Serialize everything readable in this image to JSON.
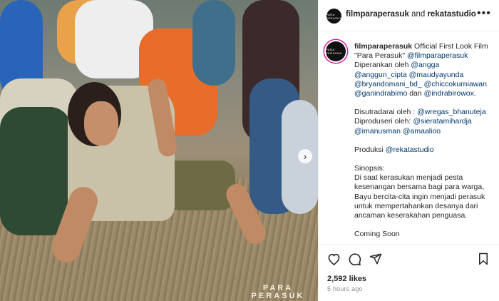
{
  "header": {
    "account": "filmparaperasuk",
    "joiner": "and",
    "collaborator": "rekatastudio",
    "avatar_text": "PARA PERASUK"
  },
  "media": {
    "watermark_line1": "PARA",
    "watermark_line2": "PERASUK",
    "next_glyph": "›"
  },
  "caption": {
    "username": "filmparaperasuk",
    "line1": "Official First Look Film \"Para Perasuk\"",
    "handle_main": "@filmparaperasuk",
    "directed_label": "Diperankan oleh",
    "cast": [
      "@angga",
      "@anggun_cipta",
      "@maudyayunda",
      "@bryandomani_bd_",
      "@chiccokurniawan",
      "@ganindrabimo"
    ],
    "cast_joiner": "dan",
    "cast_last": "@indrabirowox",
    "cast_end": ".",
    "writer_label": "Disutradarai oleh :",
    "writer": "@wregas_bhanuteja",
    "producer_label": "Diproduseri oleh:",
    "producers": [
      "@sieratamihardja",
      "@imanusman",
      "@amaalioo"
    ],
    "production_label": "Produksi",
    "production": "@rekatastudio",
    "synopsis_label": "Sinopsis:",
    "synopsis": "Di saat kerasukan menjadi pesta kesenangan bersama bagi para warga, Bayu bercita-cita ingin menjadi perasuk untuk mempertahankan desanya dari ancaman keserakahan penguasa.",
    "coming_soon": "Coming Soon"
  },
  "actions": {
    "icons": [
      "heart-icon",
      "comment-icon",
      "share-icon",
      "bookmark-icon"
    ],
    "likes": "2,592 likes",
    "time": "5 hours ago"
  },
  "colors": {
    "mention": "#00376b",
    "text": "#262626",
    "muted": "#8e8e8e",
    "story_ring": "#d6249f"
  }
}
